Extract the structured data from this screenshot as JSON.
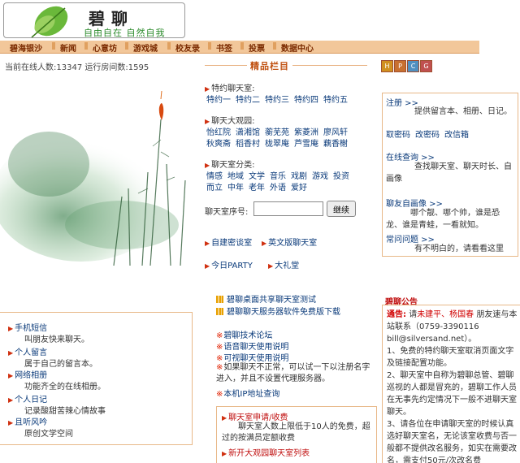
{
  "header": {
    "logo_title": "碧聊",
    "logo_subtitle": "自由自在 自然自我"
  },
  "nav": [
    "碧海银沙",
    "新闻",
    "心意坊",
    "游戏城",
    "校友录",
    "书签",
    "投票",
    "数据中心"
  ],
  "status": {
    "online_text": "当前在线人数:13347 运行房间数:1595"
  },
  "picks": {
    "title": "精品栏目",
    "special_title": "特约聊天室:",
    "special_links": [
      "特约一",
      "特约二",
      "特约三",
      "特约四",
      "特约五"
    ],
    "garden_title": "聊天大观园:",
    "garden_row1": [
      "怡红院",
      "潇湘馆",
      "蘅芜苑",
      "紫菱洲",
      "廖风轩"
    ],
    "garden_row2": [
      "秋爽斋",
      "稻香村",
      "栊翠庵",
      "芦雪庵",
      "藕香榭"
    ],
    "category_title": "聊天室分类:",
    "category_row1": [
      "情感",
      "地域",
      "文学",
      "音乐",
      "戏剧",
      "游戏",
      "投资"
    ],
    "category_row2": [
      "而立",
      "中年",
      "老年",
      "外语",
      "爱好"
    ],
    "room_label": "聊天室序号:",
    "room_input_value": "",
    "go_label": "继续",
    "link_password": "自建密谈室",
    "link_english": "英文版聊天室",
    "link_party": "今日PARTY",
    "link_hall": "大礼堂",
    "promo1": "碧聊桌面共享聊天室测试",
    "promo2": "碧聊聊天服务器软件免费版下载",
    "tech1": "碧聊技术论坛",
    "tech2": "语音聊天使用说明",
    "tech3": "可视聊天使用说明",
    "tech4": "如果聊天不正常，可以试一下以注册名字进入，并且不设置代理服务器。",
    "tech5": "本机IP地址查询"
  },
  "tiles": [
    "H",
    "P",
    "C",
    "G"
  ],
  "right_panel": {
    "register_head": "注册 >>",
    "register_text": "提供留言本、相册、日记。",
    "register_links": [
      "取密码",
      "改密码",
      "改信箱"
    ],
    "query_head": "在线查询 >>",
    "query_text": "查找聊天室、聊天时长、自画像",
    "portrait_head": "聊友自画像 >>",
    "portrait_text": "哪个靓、哪个帅，谁是恐龙、谁是青蛙，一看就知。",
    "faq_head": "常问问题 >>",
    "faq_text": "有不明白的，请看看这里"
  },
  "notice": {
    "title": "碧聊公告",
    "lead": "通告:",
    "lead_text_1": "请",
    "lead_names": "未建平、杨国春",
    "lead_text_2": "朋友速与本站联系（0759-3390116 bill@silversand.net）。",
    "item1": "1、免费的特约聊天室取消页面文字及链接配置功能。",
    "item2": "2、聊天室中自称为碧聊总管、碧聊巡视的人都是冒充的，碧聊工作人员在无事先约定情况下一般不进聊天室聊天。",
    "item3": "3、请各位在申请聊天室的时候认真选好聊天室名，无论该室收费与否一般都不提供改名服务，如实在需要改名，需支付50元/次改名费"
  },
  "left_box": [
    {
      "head": "手机短信",
      "text": "叫朋友快来聊天。"
    },
    {
      "head": "个人留言",
      "text": "属于自己的留言本。"
    },
    {
      "head": "网络相册",
      "text": "功能齐全的在线相册。"
    },
    {
      "head": "个人日记",
      "text": "记录酸甜苦辣心情故事"
    },
    {
      "head": "且听风吟",
      "text": "原创文学空间"
    }
  ],
  "chat_box": {
    "head": "聊天室申请/收费",
    "text": "聊天室人数上限低于10人的免费，超过的按满员定额收费",
    "link": "新开大观园聊天室列表"
  },
  "colors": {
    "nav_bg": "#f2c79a",
    "link": "#0a3a7a",
    "accent": "#d03010",
    "border": "#e8b888"
  }
}
